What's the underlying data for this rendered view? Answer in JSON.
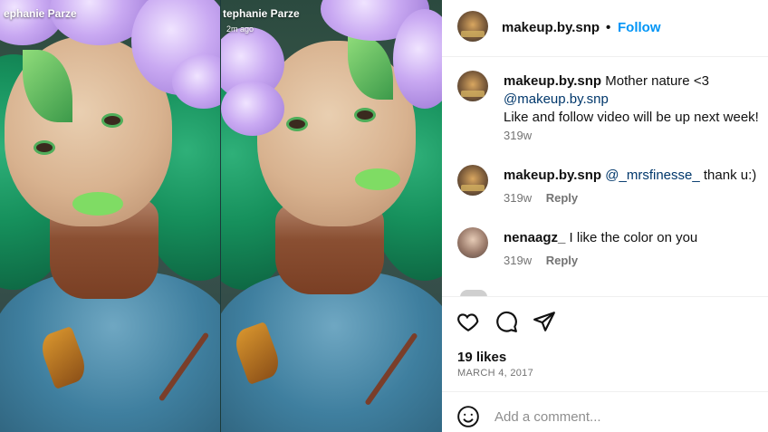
{
  "media": {
    "left_caption": "ephanie Parze",
    "right_caption": "tephanie Parze",
    "right_time": "2m ago"
  },
  "post": {
    "username": "makeup.by.snp",
    "separator": "•",
    "follow_label": "Follow"
  },
  "comments": [
    {
      "username": "makeup.by.snp",
      "text": "Mother nature <3",
      "mention": "@makeup.by.snp",
      "extra": "Like and follow video will be up next week!",
      "time": "319w",
      "reply_label": ""
    },
    {
      "username": "makeup.by.snp",
      "mention": "@_mrsfinesse_",
      "text": "thank u:)",
      "time": "319w",
      "reply_label": "Reply"
    },
    {
      "username": "nenaagz_",
      "text": "I like the color on you",
      "time": "319w",
      "reply_label": "Reply"
    }
  ],
  "actions": {
    "like_icon": "heart-icon",
    "comment_icon": "comment-icon",
    "share_icon": "share-icon"
  },
  "likes": "19 likes",
  "date": "MARCH 4, 2017",
  "add_comment": {
    "placeholder": "Add a comment...",
    "emoji_icon": "emoji-icon"
  },
  "colors": {
    "follow": "#0095f6",
    "meta": "#737373",
    "mention": "#00376b"
  }
}
